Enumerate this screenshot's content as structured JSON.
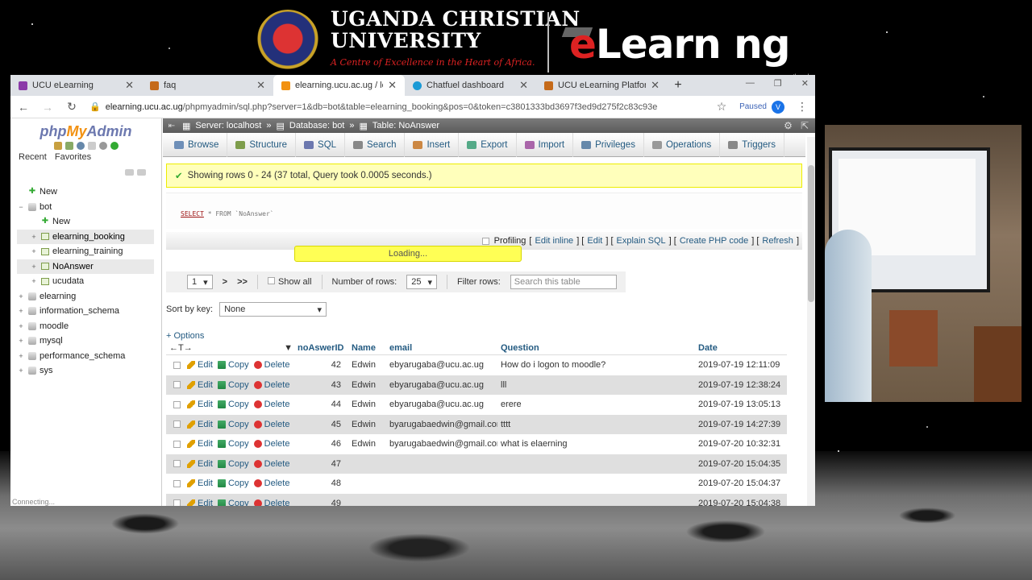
{
  "banner": {
    "university": "UGANDA CHRISTIAN",
    "university2": "UNIVERSITY",
    "tagline": "A Centre of Excellence in the Heart of Africa.",
    "elearning_e": "e",
    "elearning_rest": "Learn ng",
    "smartboard": "smartboard"
  },
  "browser": {
    "tabs": [
      {
        "label": "UCU eLearning",
        "fav_color": "#8b3aa8"
      },
      {
        "label": "faq",
        "fav_color": "#c56a1a"
      },
      {
        "label": "elearning.ucu.ac.ug / localh",
        "fav_color": "#f29111"
      },
      {
        "label": "Chatfuel dashboard",
        "fav_color": "#1a9ad6"
      },
      {
        "label": "UCU eLearning Platform",
        "fav_color": "#c56a1a"
      }
    ],
    "url_host": "elearning.ucu.ac.ug",
    "url_rest": "/phpmyadmin/sql.php?server=1&db=bot&table=elearning_booking&pos=0&token=c3801333bd3697f3ed9d275f2c83c93e",
    "paused_label": "Paused",
    "avatar_letter": "V"
  },
  "pma": {
    "logo_php": "php",
    "logo_my": "My",
    "logo_admin": "Admin",
    "recent": "Recent",
    "favorites": "Favorites",
    "tree": [
      {
        "label": "New",
        "level": 0,
        "kind": "new"
      },
      {
        "label": "bot",
        "level": 0,
        "kind": "db"
      },
      {
        "label": "New",
        "level": 1,
        "kind": "new"
      },
      {
        "label": "elearning_booking",
        "level": 1,
        "kind": "table",
        "hl": true
      },
      {
        "label": "elearning_training",
        "level": 1,
        "kind": "table"
      },
      {
        "label": "NoAnswer",
        "level": 1,
        "kind": "table",
        "hl": true
      },
      {
        "label": "ucudata",
        "level": 1,
        "kind": "table"
      },
      {
        "label": "elearning",
        "level": 0,
        "kind": "db"
      },
      {
        "label": "information_schema",
        "level": 0,
        "kind": "db"
      },
      {
        "label": "moodle",
        "level": 0,
        "kind": "db"
      },
      {
        "label": "mysql",
        "level": 0,
        "kind": "db"
      },
      {
        "label": "performance_schema",
        "level": 0,
        "kind": "db"
      },
      {
        "label": "sys",
        "level": 0,
        "kind": "db"
      }
    ],
    "status": "Connecting...",
    "breadcrumb": {
      "server": "Server: localhost",
      "database": "Database: bot",
      "table": "Table: NoAnswer"
    },
    "menu": [
      {
        "label": "Browse",
        "color": "#6e8fb8"
      },
      {
        "label": "Structure",
        "color": "#7e9d4b"
      },
      {
        "label": "SQL",
        "color": "#6c78af"
      },
      {
        "label": "Search",
        "color": "#888"
      },
      {
        "label": "Insert",
        "color": "#c84"
      },
      {
        "label": "Export",
        "color": "#5a8"
      },
      {
        "label": "Import",
        "color": "#a6a"
      },
      {
        "label": "Privileges",
        "color": "#68a"
      },
      {
        "label": "Operations",
        "color": "#999"
      },
      {
        "label": "Triggers",
        "color": "#888"
      }
    ],
    "notice": "Showing rows 0 - 24 (37 total, Query took 0.0005 seconds.)",
    "sql_kw": "SELECT",
    "sql_rest": " * FROM `NoAnswer`",
    "profiling": "Profiling",
    "profile_links": [
      "Edit inline",
      "Edit",
      "Explain SQL",
      "Create PHP code",
      "Refresh"
    ],
    "loading": "Loading...",
    "page_select": "1",
    "next": ">",
    "last": ">>",
    "show_all": "Show all",
    "num_rows_label": "Number of rows:",
    "num_rows": "25",
    "filter_label": "Filter rows:",
    "filter_placeholder": "Search this table",
    "sort_label": "Sort by key:",
    "sort_value": "None",
    "options": "+ Options",
    "columns": [
      "noAswerID",
      "Name",
      "email",
      "Question",
      "Date"
    ],
    "actions": {
      "edit": "Edit",
      "copy": "Copy",
      "delete": "Delete"
    },
    "rows": [
      {
        "id": "42",
        "name": "Edwin",
        "email": "ebyarugaba@ucu.ac.ug",
        "question": "How do i logon to moodle?",
        "date": "2019-07-19 12:11:09"
      },
      {
        "id": "43",
        "name": "Edwin",
        "email": "ebyarugaba@ucu.ac.ug",
        "question": "lll",
        "date": "2019-07-19 12:38:24"
      },
      {
        "id": "44",
        "name": "Edwin",
        "email": "ebyarugaba@ucu.ac.ug",
        "question": "erere",
        "date": "2019-07-19 13:05:13"
      },
      {
        "id": "45",
        "name": "Edwin",
        "email": "byarugabaedwin@gmail.com",
        "question": "tttt",
        "date": "2019-07-19 14:27:39"
      },
      {
        "id": "46",
        "name": "Edwin",
        "email": "byarugabaedwin@gmail.com",
        "question": "what is elaerning",
        "date": "2019-07-20 10:32:31"
      },
      {
        "id": "47",
        "name": "",
        "email": "",
        "question": "",
        "date": "2019-07-20 15:04:35"
      },
      {
        "id": "48",
        "name": "",
        "email": "",
        "question": "",
        "date": "2019-07-20 15:04:37"
      },
      {
        "id": "49",
        "name": "",
        "email": "",
        "question": "",
        "date": "2019-07-20 15:04:38"
      }
    ]
  }
}
